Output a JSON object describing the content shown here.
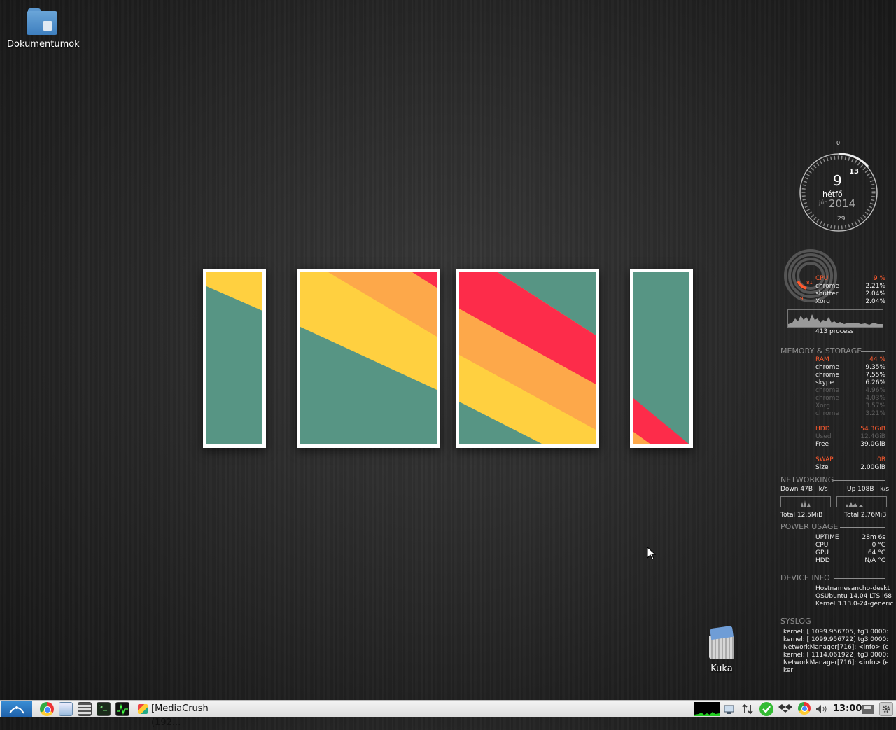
{
  "desktop": {
    "icons": [
      {
        "label": "Dokumentumok"
      },
      {
        "label": "Kuka"
      }
    ]
  },
  "widget_clock": {
    "day": "9",
    "weekday": "hétfő",
    "month": "jún",
    "year": "2014",
    "top_tick": "0",
    "hour_mark": "13",
    "bottom_mark": "29"
  },
  "cpu": {
    "label": "CPU",
    "percent": "9 %",
    "ring_a": "81",
    "ring_b": "9",
    "processes": [
      {
        "name": "chrome",
        "value": "2.21%"
      },
      {
        "name": "shutter",
        "value": "2.04%"
      },
      {
        "name": "Xorg",
        "value": "2.04%"
      }
    ],
    "process_count": "413 process"
  },
  "memory": {
    "title": "MEMORY & STORAGE",
    "ram_label": "RAM",
    "ram_percent": "44 %",
    "processes": [
      {
        "name": "chrome",
        "value": "9.35%"
      },
      {
        "name": "chrome",
        "value": "7.55%"
      },
      {
        "name": "skype",
        "value": "6.26%"
      },
      {
        "name": "chrome",
        "value": "4.96%"
      },
      {
        "name": "chrome",
        "value": "4.03%"
      },
      {
        "name": "Xorg",
        "value": "3.57%"
      },
      {
        "name": "chrome",
        "value": "3.21%"
      }
    ],
    "hdd_label": "HDD",
    "hdd_total": "54.3GiB",
    "hdd_used_label": "Used",
    "hdd_used": "12.4GiB",
    "hdd_free_label": "Free",
    "hdd_free": "39.0GiB",
    "swap_label": "SWAP",
    "swap_value": "0B",
    "swap_size_label": "Size",
    "swap_size": "2.00GiB"
  },
  "networking": {
    "title": "NETWORKING",
    "down": "Down 47B   k/s",
    "up": "Up 108B   k/s",
    "total_down": "Total 12.5MiB",
    "total_up": "Total 2.76MiB"
  },
  "power": {
    "title": "POWER USAGE",
    "rows": [
      {
        "name": "UPTIME",
        "value": "28m 6s"
      },
      {
        "name": "CPU",
        "value": "0 °C"
      },
      {
        "name": "GPU",
        "value": "64 °C"
      },
      {
        "name": "HDD",
        "value": "N/A °C"
      }
    ]
  },
  "device": {
    "title": "DEVICE INFO",
    "lines": [
      "Hostnamesancho-deskt",
      "OSUbuntu 14.04 LTS i68",
      "Kernel 3.13.0-24-generic"
    ]
  },
  "syslog": {
    "title": "SYSLOG",
    "lines": [
      "kernel: [ 1099.956705] tg3 0000:02:",
      "kernel: [ 1099.956722] tg3 0000:02:",
      "NetworkManager[716]: <info> (et",
      "kernel: [ 1114.061922] tg3 0000:02:",
      "NetworkManager[716]: <info> (et",
      "ker"
    ]
  },
  "taskbar": {
    "task_label": "[MediaCrush (192...",
    "clock": "13:00"
  },
  "colors": {
    "teal": "#579584",
    "yellow": "#ffd040",
    "orange": "#fda84a",
    "red": "#fd2c4a",
    "accent": "#ff5a2e"
  }
}
